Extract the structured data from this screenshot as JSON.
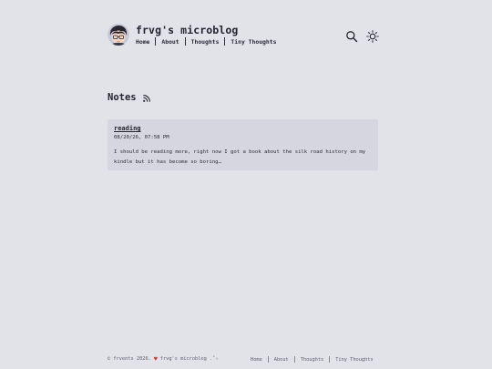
{
  "site": {
    "title": "frvg's microblog"
  },
  "nav": {
    "items": [
      "Home",
      "About",
      "Thoughts",
      "Tiny Thoughts"
    ]
  },
  "header_icons": [
    "search-icon",
    "sun-icon"
  ],
  "section": {
    "title": "Notes",
    "icon": "rss-icon"
  },
  "note": {
    "title": "reading",
    "date": "08/20/26, 07:58 PM",
    "body": "I should be reading more, right now I got a book about the silk road history on my kindle but it has become so boring…"
  },
  "footer": {
    "copyright": "© frvents 2026.",
    "heart": "♥",
    "tagline": "frvg's microblog .˚✧",
    "nav": [
      "Home",
      "About",
      "Thoughts",
      "Tiny Thoughts"
    ]
  },
  "colors": {
    "background": "#e2e3e9",
    "card": "#d5d6df",
    "text": "#23232f",
    "heart": "#e0302f"
  }
}
